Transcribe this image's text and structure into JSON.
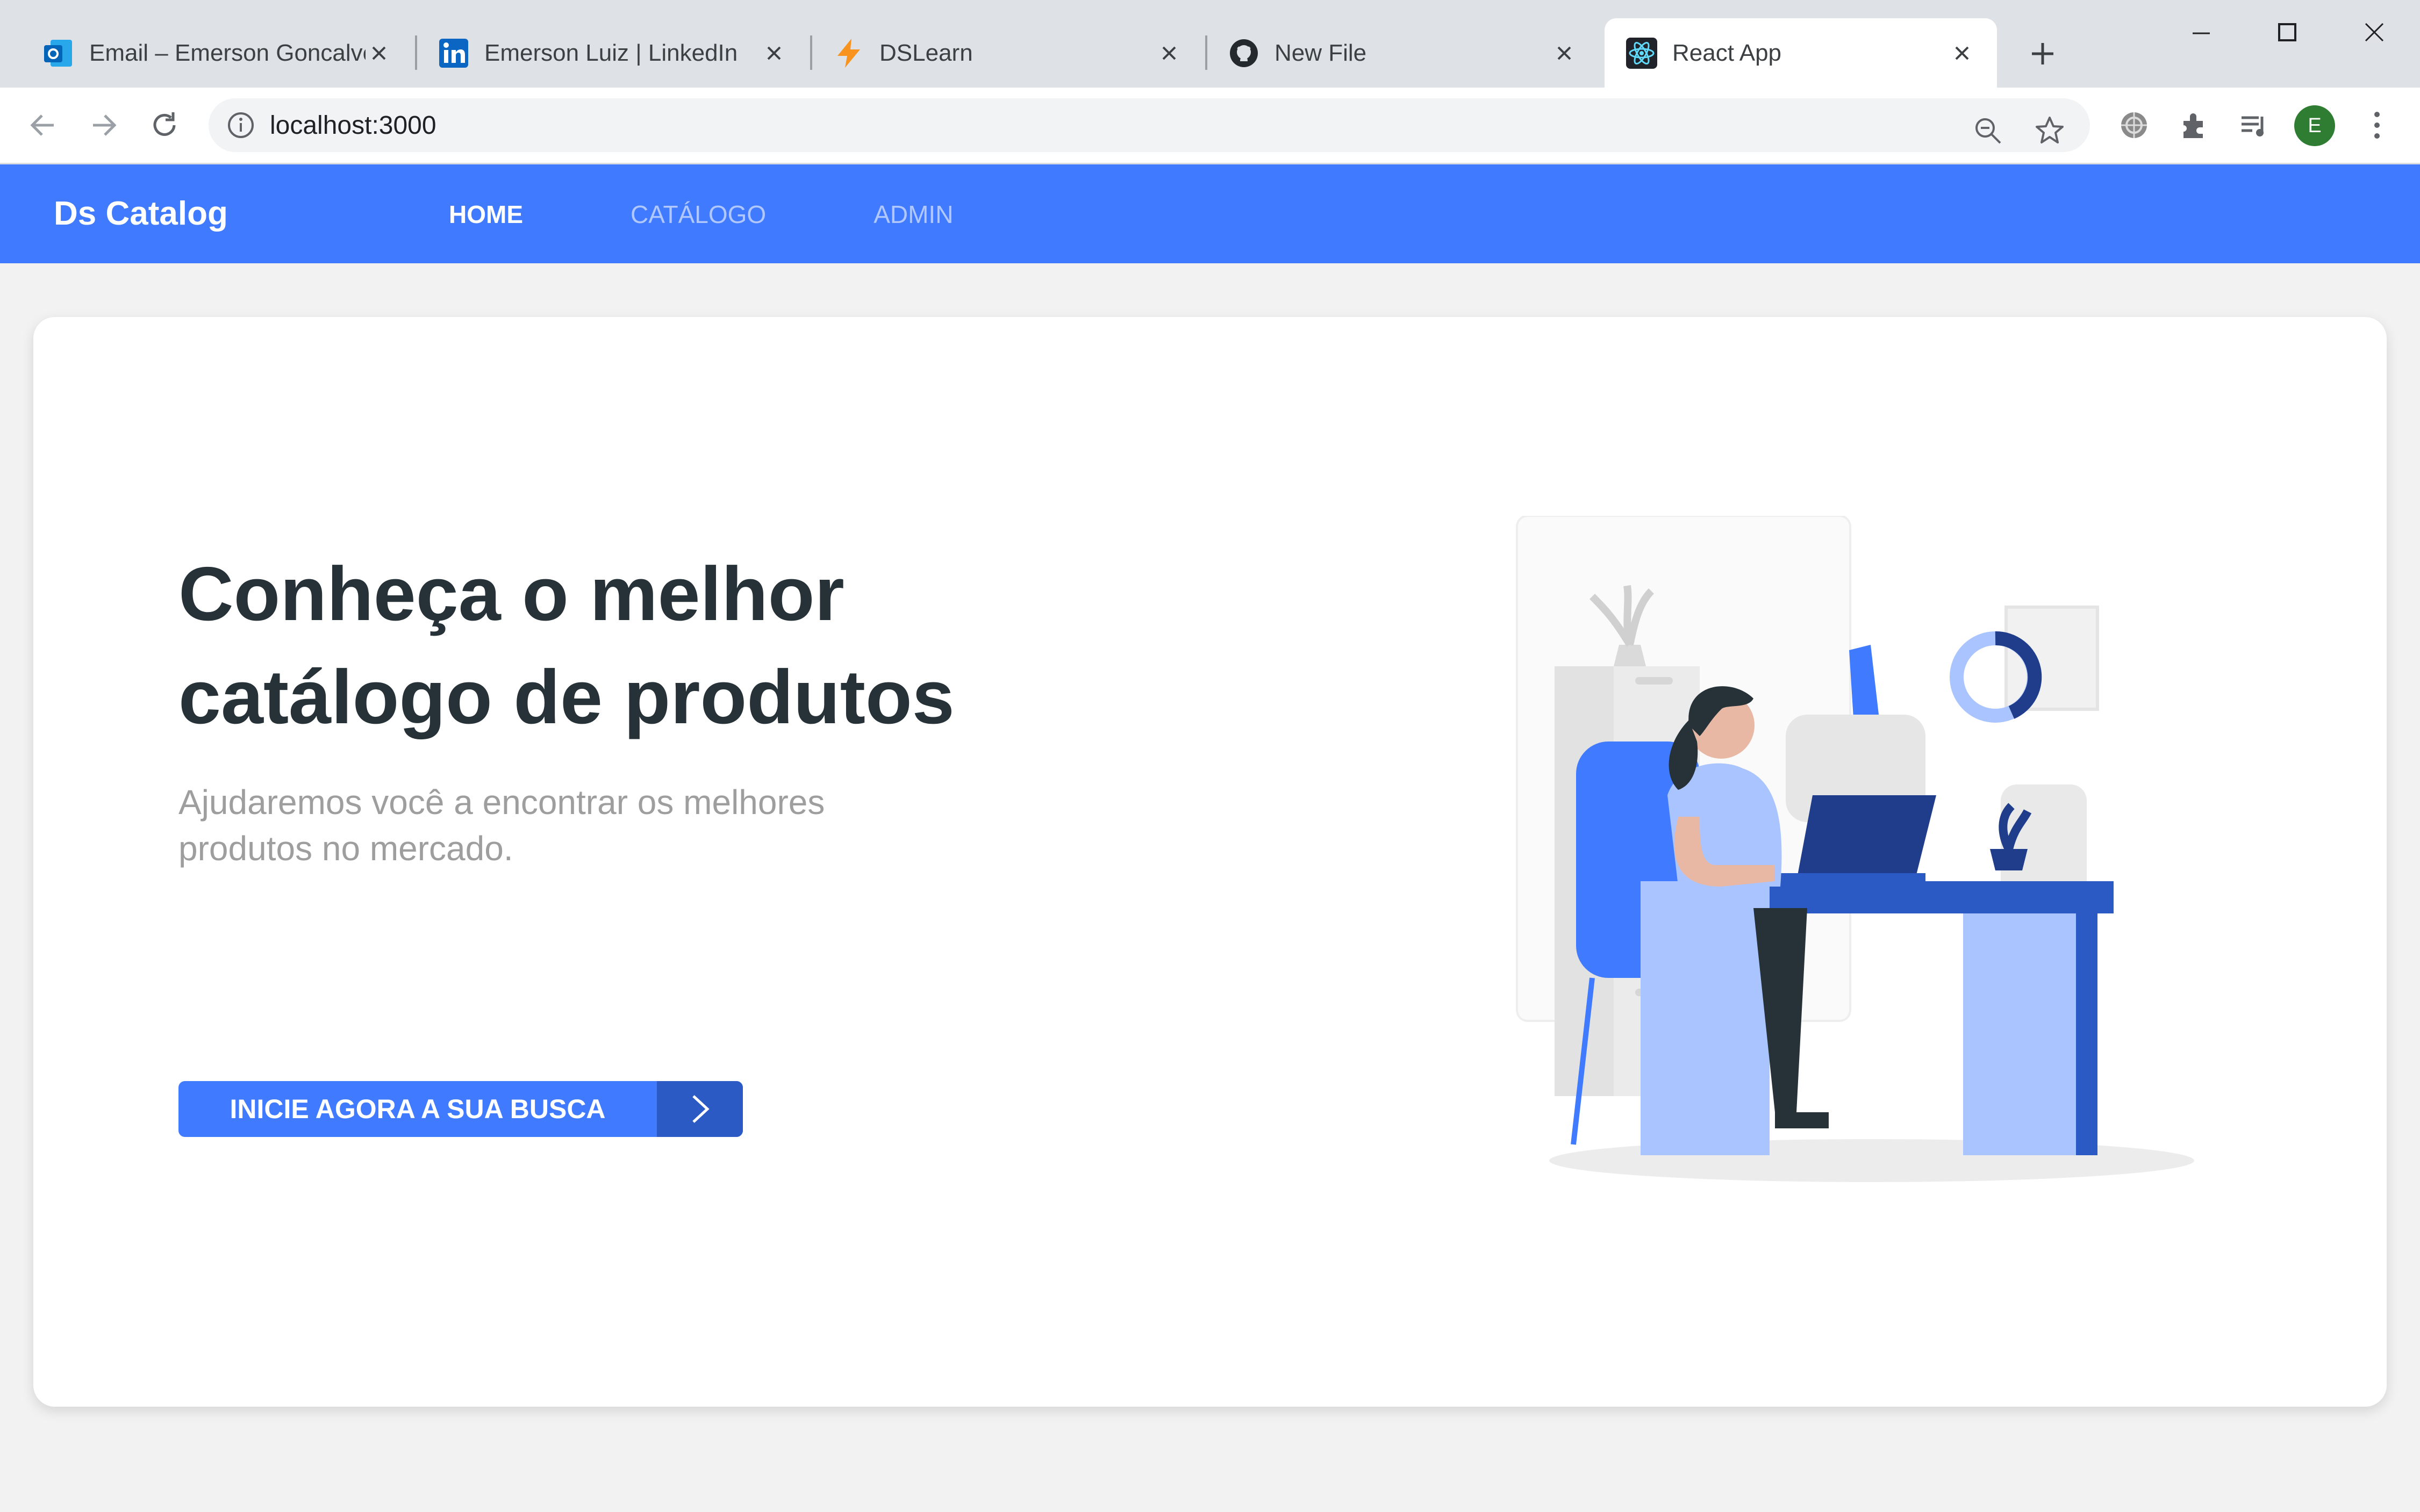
{
  "browser": {
    "tabs": [
      {
        "title": "Email – Emerson Goncalves",
        "icon": "outlook-icon",
        "active": false
      },
      {
        "title": "Emerson Luiz | LinkedIn",
        "icon": "linkedin-icon",
        "active": false
      },
      {
        "title": "DSLearn",
        "icon": "lightning-icon",
        "active": false
      },
      {
        "title": "New File",
        "icon": "github-icon",
        "active": false
      },
      {
        "title": "React App",
        "icon": "react-icon",
        "active": true
      }
    ],
    "url": "localhost:3000",
    "profile_initial": "E",
    "colors": {
      "tabstrip": "#dee1e6",
      "toolbar": "#ffffff"
    }
  },
  "navbar": {
    "brand": "Ds Catalog",
    "links": [
      {
        "label": "HOME",
        "active": true
      },
      {
        "label": "CATÁLOGO",
        "active": false
      },
      {
        "label": "ADMIN",
        "active": false
      }
    ],
    "color": "#407bff"
  },
  "hero": {
    "title_line1": "Conheça o melhor",
    "title_line2": "catálogo de produtos",
    "subtitle_line1": "Ajudaremos você a encontrar os melhores",
    "subtitle_line2": "produtos no mercado.",
    "cta_label": "INICIE AGORA A SUA BUSCA",
    "cta_icon": "chevron-right-icon",
    "illustration": "woman-at-desk-illustration"
  }
}
